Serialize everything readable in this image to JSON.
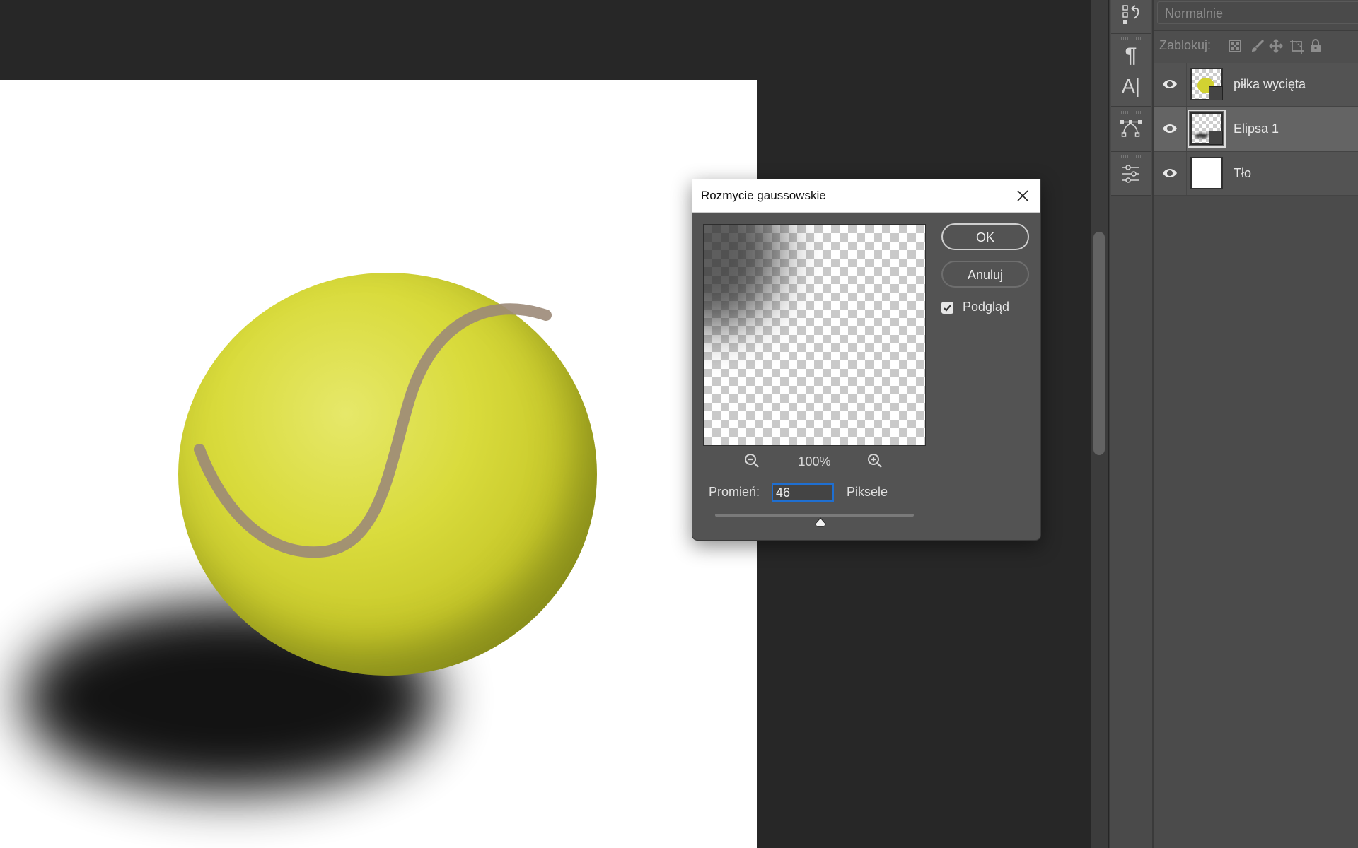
{
  "layers_panel": {
    "blend_mode": "Normalnie",
    "lock_label": "Zablokuj:",
    "lock_icons": [
      "lock-transparent-pixels-icon",
      "lock-image-pixels-icon",
      "lock-position-icon",
      "lock-artboard-icon",
      "lock-all-icon"
    ],
    "layers": [
      {
        "name": "piłka wycięta",
        "visible": true,
        "selected": false,
        "thumb": "ball",
        "smart_object": true
      },
      {
        "name": "Elipsa 1",
        "visible": true,
        "selected": true,
        "thumb": "shadow",
        "smart_object": true
      },
      {
        "name": "Tło",
        "visible": true,
        "selected": false,
        "thumb": "white",
        "smart_object": false
      }
    ]
  },
  "icon_column": [
    "history-icon",
    "paragraph-icon",
    "character-icon",
    "paths-icon",
    "adjustments-icon"
  ],
  "dialog": {
    "title": "Rozmycie gaussowskie",
    "ok_label": "OK",
    "cancel_label": "Anuluj",
    "preview_label": "Podgląd",
    "preview_checked": true,
    "zoom_value": "100%",
    "radius_label": "Promień:",
    "radius_value": "46",
    "radius_unit": "Piksele",
    "slider_fraction": 0.53
  },
  "colors": {
    "accent": "#1f6fd1",
    "ball": "#d9db3c",
    "seam": "#9c8a78"
  }
}
